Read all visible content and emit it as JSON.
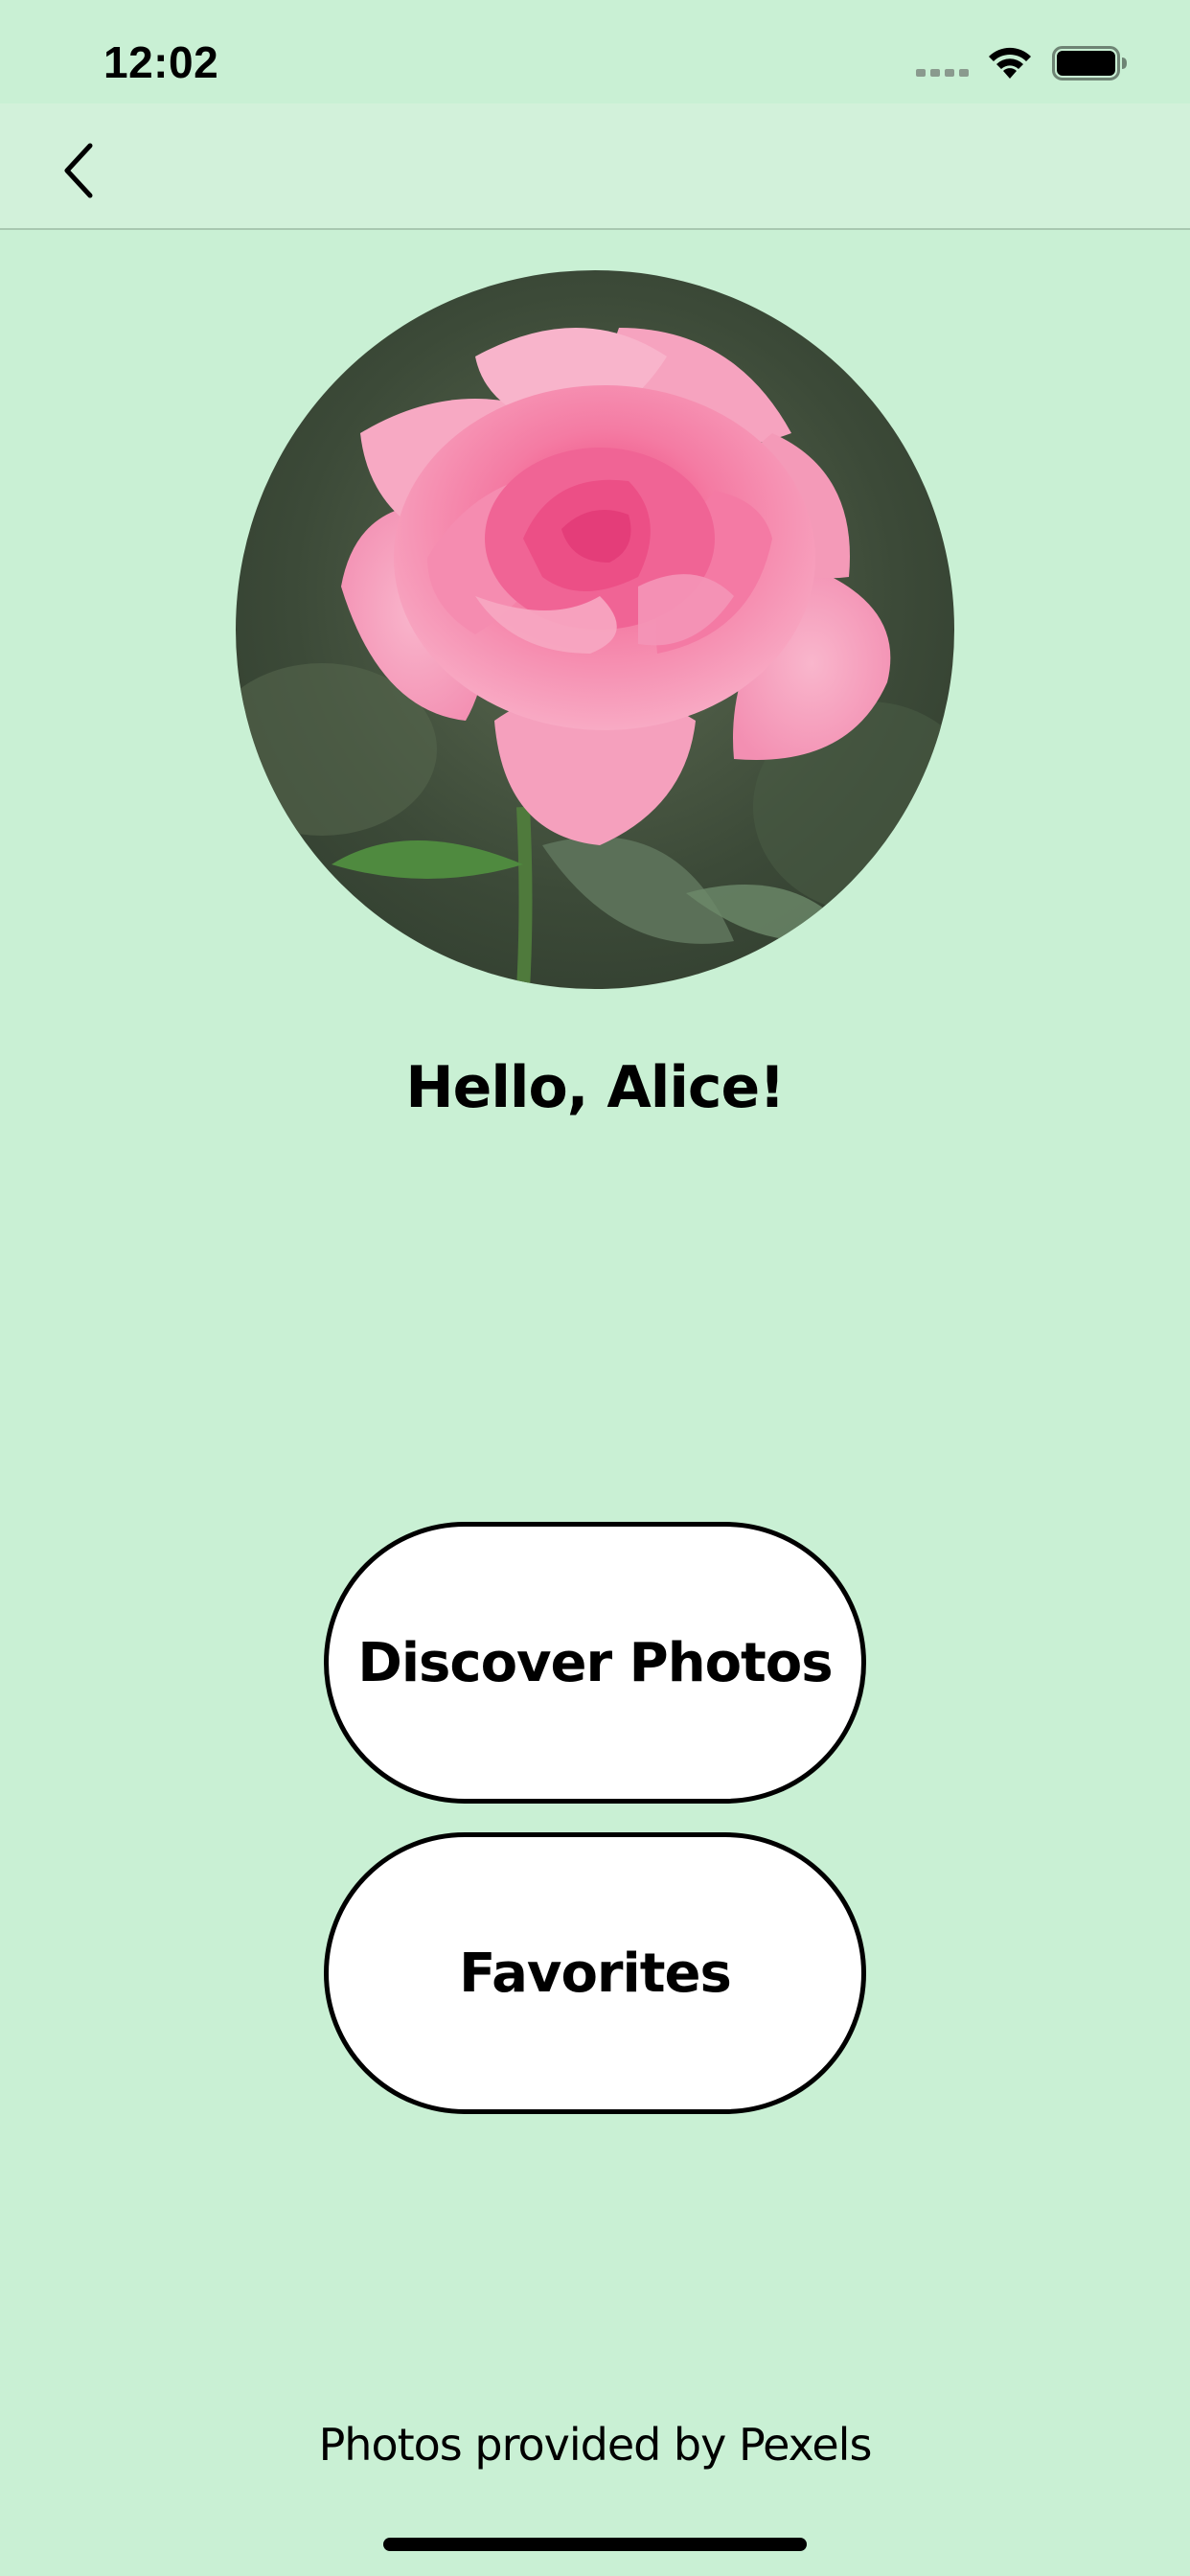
{
  "status_bar": {
    "time": "12:02",
    "icons": [
      "cellular-signal-icon",
      "wifi-icon",
      "battery-icon"
    ]
  },
  "nav": {
    "back_icon": "chevron-left-icon"
  },
  "profile": {
    "avatar_subject": "pink rose",
    "greeting": "Hello, Alice!"
  },
  "actions": {
    "discover_label": "Discover Photos",
    "favorites_label": "Favorites"
  },
  "footer": {
    "credits": "Photos provided by Pexels"
  },
  "colors": {
    "background": "#c9f0d4",
    "nav_background": "#d2f1da",
    "button_fill": "#ffffff",
    "button_border": "#000000",
    "text": "#000000"
  }
}
